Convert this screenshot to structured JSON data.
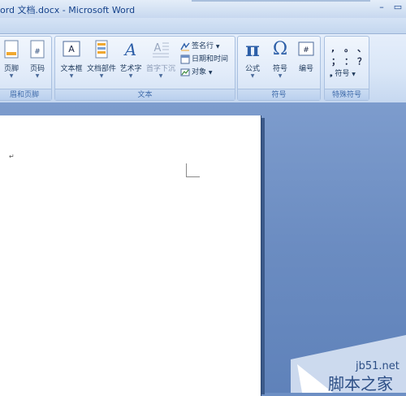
{
  "window": {
    "title": "ord 文档.docx - Microsoft Word",
    "minimize": "–",
    "restore": "▭"
  },
  "groups": [
    {
      "id": "header-footer",
      "caption": "眉和页脚"
    },
    {
      "id": "text",
      "caption": "文本"
    },
    {
      "id": "symbols",
      "caption": "符号"
    },
    {
      "id": "special-symbols",
      "caption": "特殊符号"
    }
  ],
  "buttons": {
    "footer": "页脚",
    "page_number": "页码",
    "textbox": "文本框",
    "quick_parts": "文档部件",
    "wordart": "艺术字",
    "dropcap": "首字下沉",
    "signature_line": "签名行",
    "date_time": "日期和时间",
    "object": "对象",
    "equation": "公式",
    "symbol": "符号",
    "numbering": "编号",
    "special_symbol": "符号"
  },
  "special_symbols": [
    ",",
    "。",
    "、",
    "；",
    "：",
    "？"
  ],
  "symbol_glyphs": {
    "pi": "π",
    "omega": "Ω",
    "hash": "#"
  },
  "document": {
    "paragraph_mark": "↵"
  },
  "watermark": {
    "site": "jb51.net",
    "name": "脚本之家"
  }
}
